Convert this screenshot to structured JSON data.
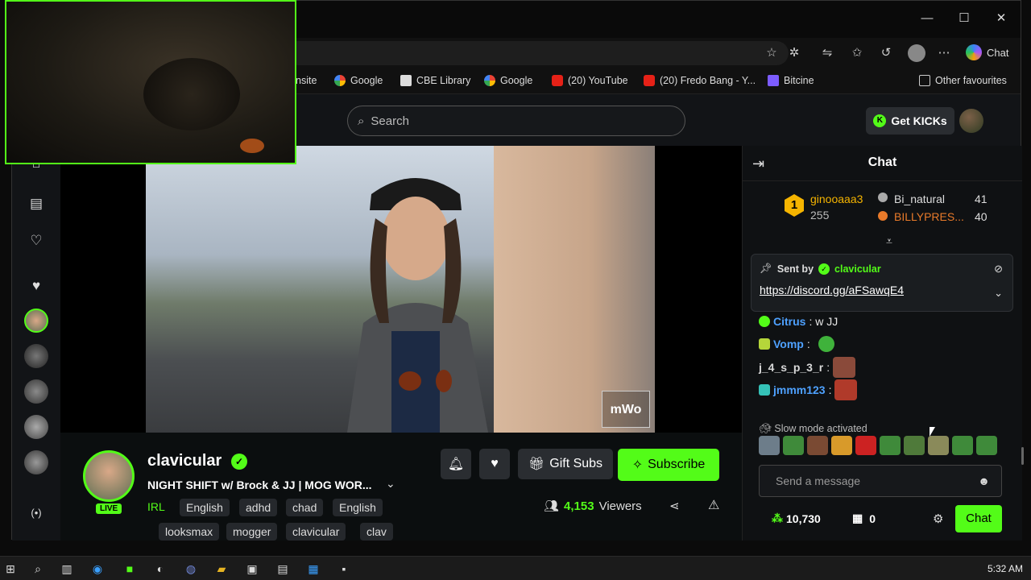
{
  "browser": {
    "bookmarks": [
      {
        "label": "nsite",
        "icon": "site-icon"
      },
      {
        "label": "Google",
        "icon": "google-icon"
      },
      {
        "label": "CBE Library",
        "icon": "library-icon"
      },
      {
        "label": "Google",
        "icon": "google-icon"
      },
      {
        "label": "(20) YouTube",
        "icon": "youtube-icon"
      },
      {
        "label": "(20) Fredo Bang - Y...",
        "icon": "youtube-icon"
      },
      {
        "label": "Bitcine",
        "icon": "bitcine-icon"
      }
    ],
    "other_favourites": "Other favourites",
    "copilot_label": "Chat"
  },
  "kick": {
    "search_placeholder": "Search",
    "get_kicks_label": "Get KICKs",
    "accent_color": "#53fc18"
  },
  "stream": {
    "streamer": "clavicular",
    "live_badge": "LIVE",
    "title": "NIGHT SHIFT w/ Brock & JJ | MOG WOR...",
    "category": "IRL",
    "tags": [
      "English",
      "adhd",
      "chad",
      "English",
      "looksmax",
      "mogger",
      "clavicular",
      "clav"
    ],
    "gift_subs_label": "Gift Subs",
    "subscribe_label": "Subscribe",
    "viewer_count": "4,153",
    "viewers_label": "Viewers",
    "watermark": "mWo"
  },
  "chat": {
    "title": "Chat",
    "leaderboard": [
      {
        "rank": "1",
        "name": "ginooaaa3",
        "amount": "255"
      },
      {
        "rank": "2",
        "name": "Bi_natural",
        "amount": "41"
      },
      {
        "rank": "3",
        "name": "BILLYPRES...",
        "amount": "40"
      }
    ],
    "pinned": {
      "sent_by_label": "Sent by",
      "sender": "clavicular",
      "link": "https://discord.gg/aFSawqE4"
    },
    "messages": [
      {
        "user": "Citrus",
        "text": ": w JJ",
        "color": "#4ea1ff"
      },
      {
        "user": "Vomp",
        "text": ":",
        "color": "#4ea1ff"
      },
      {
        "user": "j_4_s_p_3_r",
        "text": ":",
        "color": "#d9d9d9"
      },
      {
        "user": "jmmm123",
        "text": ":",
        "color": "#4ea1ff"
      }
    ],
    "slow_mode": "Slow mode activated",
    "send_placeholder": "Send a message",
    "points": "10,730",
    "redeem_count": "0",
    "chat_button": "Chat"
  },
  "taskbar": {
    "clock": "5:32 AM"
  }
}
